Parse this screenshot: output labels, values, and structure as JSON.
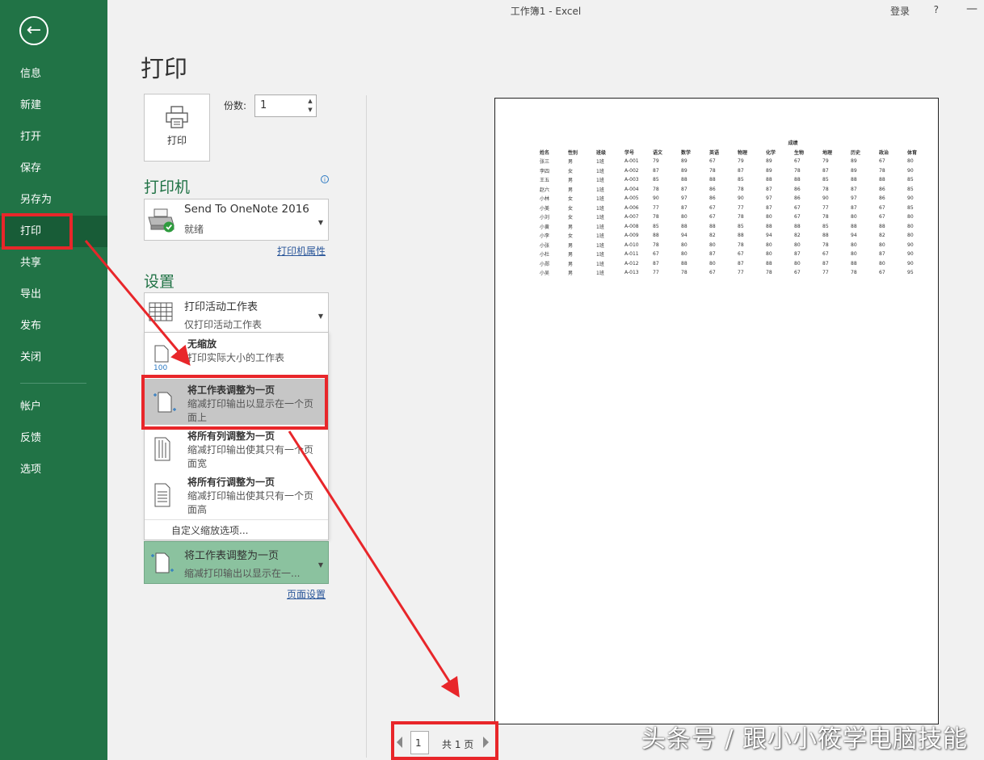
{
  "window": {
    "title": "工作簿1  -  Excel",
    "login": "登录",
    "help": "?",
    "minimize": "—"
  },
  "sidebar": {
    "back_icon": "back-arrow-icon",
    "items": [
      {
        "label": "信息"
      },
      {
        "label": "新建"
      },
      {
        "label": "打开"
      },
      {
        "label": "保存"
      },
      {
        "label": "另存为"
      },
      {
        "label": "打印",
        "active": true
      },
      {
        "label": "共享"
      },
      {
        "label": "导出"
      },
      {
        "label": "发布"
      },
      {
        "label": "关闭"
      },
      {
        "label": "帐户"
      },
      {
        "label": "反馈"
      },
      {
        "label": "选项"
      }
    ]
  },
  "print": {
    "heading": "打印",
    "button_label": "打印",
    "copies_label": "份数:",
    "copies_value": "1"
  },
  "printer": {
    "section_title": "打印机",
    "name": "Send To OneNote 2016",
    "status": "就绪",
    "properties_link": "打印机属性"
  },
  "settings": {
    "section_title": "设置",
    "sheet_option": {
      "title": "打印活动工作表",
      "sub": "仅打印活动工作表"
    },
    "scale_menu": [
      {
        "title": "无缩放",
        "desc": "打印实际大小的工作表",
        "icon_text": "100"
      },
      {
        "title": "将工作表调整为一页",
        "desc": "缩减打印输出以显示在一个页面上",
        "selected": true
      },
      {
        "title": "将所有列调整为一页",
        "desc": "缩减打印输出使其只有一个页面宽"
      },
      {
        "title": "将所有行调整为一页",
        "desc": "缩减打印输出使其只有一个页面高"
      }
    ],
    "custom_scale": "自定义缩放选项...",
    "current_scale": {
      "title": "将工作表调整为一页",
      "sub": "缩减打印输出以显示在一..."
    },
    "page_setup_link": "页面设置"
  },
  "preview": {
    "group_header": "成绩",
    "headers": [
      "姓名",
      "性别",
      "班级",
      "学号",
      "语文",
      "数学",
      "英语",
      "物理",
      "化学",
      "生物",
      "地理",
      "历史",
      "政治",
      "体育"
    ],
    "rows": [
      [
        "张三",
        "男",
        "1班",
        "A-001",
        "79",
        "89",
        "67",
        "79",
        "89",
        "67",
        "79",
        "89",
        "67",
        "80"
      ],
      [
        "李四",
        "女",
        "1班",
        "A-002",
        "87",
        "89",
        "78",
        "87",
        "89",
        "78",
        "87",
        "89",
        "78",
        "90"
      ],
      [
        "王五",
        "男",
        "1班",
        "A-003",
        "85",
        "88",
        "88",
        "85",
        "88",
        "88",
        "85",
        "88",
        "88",
        "85"
      ],
      [
        "赵六",
        "男",
        "1班",
        "A-004",
        "78",
        "87",
        "86",
        "78",
        "87",
        "86",
        "78",
        "87",
        "86",
        "85"
      ],
      [
        "小林",
        "女",
        "1班",
        "A-005",
        "90",
        "97",
        "86",
        "90",
        "97",
        "86",
        "90",
        "97",
        "86",
        "90"
      ],
      [
        "小美",
        "女",
        "1班",
        "A-006",
        "77",
        "87",
        "67",
        "77",
        "87",
        "67",
        "77",
        "87",
        "67",
        "85"
      ],
      [
        "小刘",
        "女",
        "1班",
        "A-007",
        "78",
        "80",
        "67",
        "78",
        "80",
        "67",
        "78",
        "80",
        "67",
        "80"
      ],
      [
        "小黄",
        "男",
        "1班",
        "A-008",
        "85",
        "88",
        "88",
        "85",
        "88",
        "88",
        "85",
        "88",
        "88",
        "80"
      ],
      [
        "小李",
        "女",
        "1班",
        "A-009",
        "88",
        "94",
        "82",
        "88",
        "94",
        "82",
        "88",
        "94",
        "82",
        "80"
      ],
      [
        "小张",
        "男",
        "1班",
        "A-010",
        "78",
        "80",
        "80",
        "78",
        "80",
        "80",
        "78",
        "80",
        "80",
        "90"
      ],
      [
        "小杜",
        "男",
        "1班",
        "A-011",
        "67",
        "80",
        "87",
        "67",
        "80",
        "87",
        "67",
        "80",
        "87",
        "90"
      ],
      [
        "小郑",
        "男",
        "1班",
        "A-012",
        "87",
        "88",
        "80",
        "87",
        "88",
        "80",
        "87",
        "88",
        "80",
        "90"
      ],
      [
        "小吴",
        "男",
        "1班",
        "A-013",
        "77",
        "78",
        "67",
        "77",
        "78",
        "67",
        "77",
        "78",
        "67",
        "95"
      ]
    ]
  },
  "pager": {
    "current_page": "1",
    "total_text": "共 1 页"
  },
  "annotation_color": "#e8262a",
  "watermark": "头条号 / 跟小小筱学电脑技能"
}
